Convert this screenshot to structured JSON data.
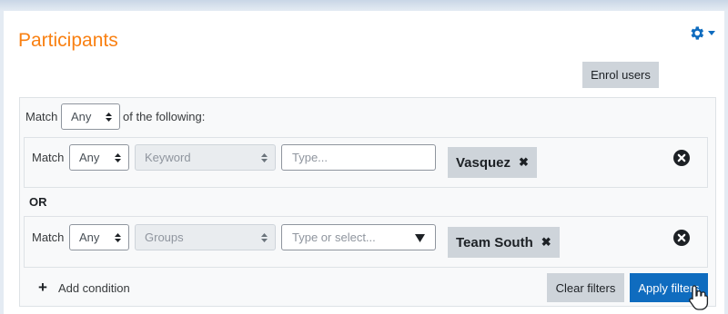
{
  "page": {
    "title": "Participants"
  },
  "header": {
    "settings_icon": "gear-icon",
    "menu_caret_icon": "caret-down-icon",
    "accent_color": "#0f6cbf"
  },
  "enrol_users_label": "Enrol users",
  "filters": {
    "root": {
      "match_label": "Match",
      "match_value": "Any",
      "suffix": "of the following:"
    },
    "rows": [
      {
        "match_label": "Match",
        "match_value": "Any",
        "type_value": "Keyword",
        "input_placeholder": "Type...",
        "selection": "Vasquez",
        "remove_icon": "close-circle-icon"
      },
      {
        "match_label": "Match",
        "match_value": "Any",
        "type_value": "Groups",
        "input_placeholder": "Type or select...",
        "selection": "Team South",
        "remove_icon": "close-circle-icon"
      }
    ],
    "join_label": "OR",
    "add_condition_label": "Add condition",
    "clear_label": "Clear filters",
    "apply_label": "Apply filters"
  },
  "tag_remove_glyph": "✖",
  "title_color": "#f98012"
}
